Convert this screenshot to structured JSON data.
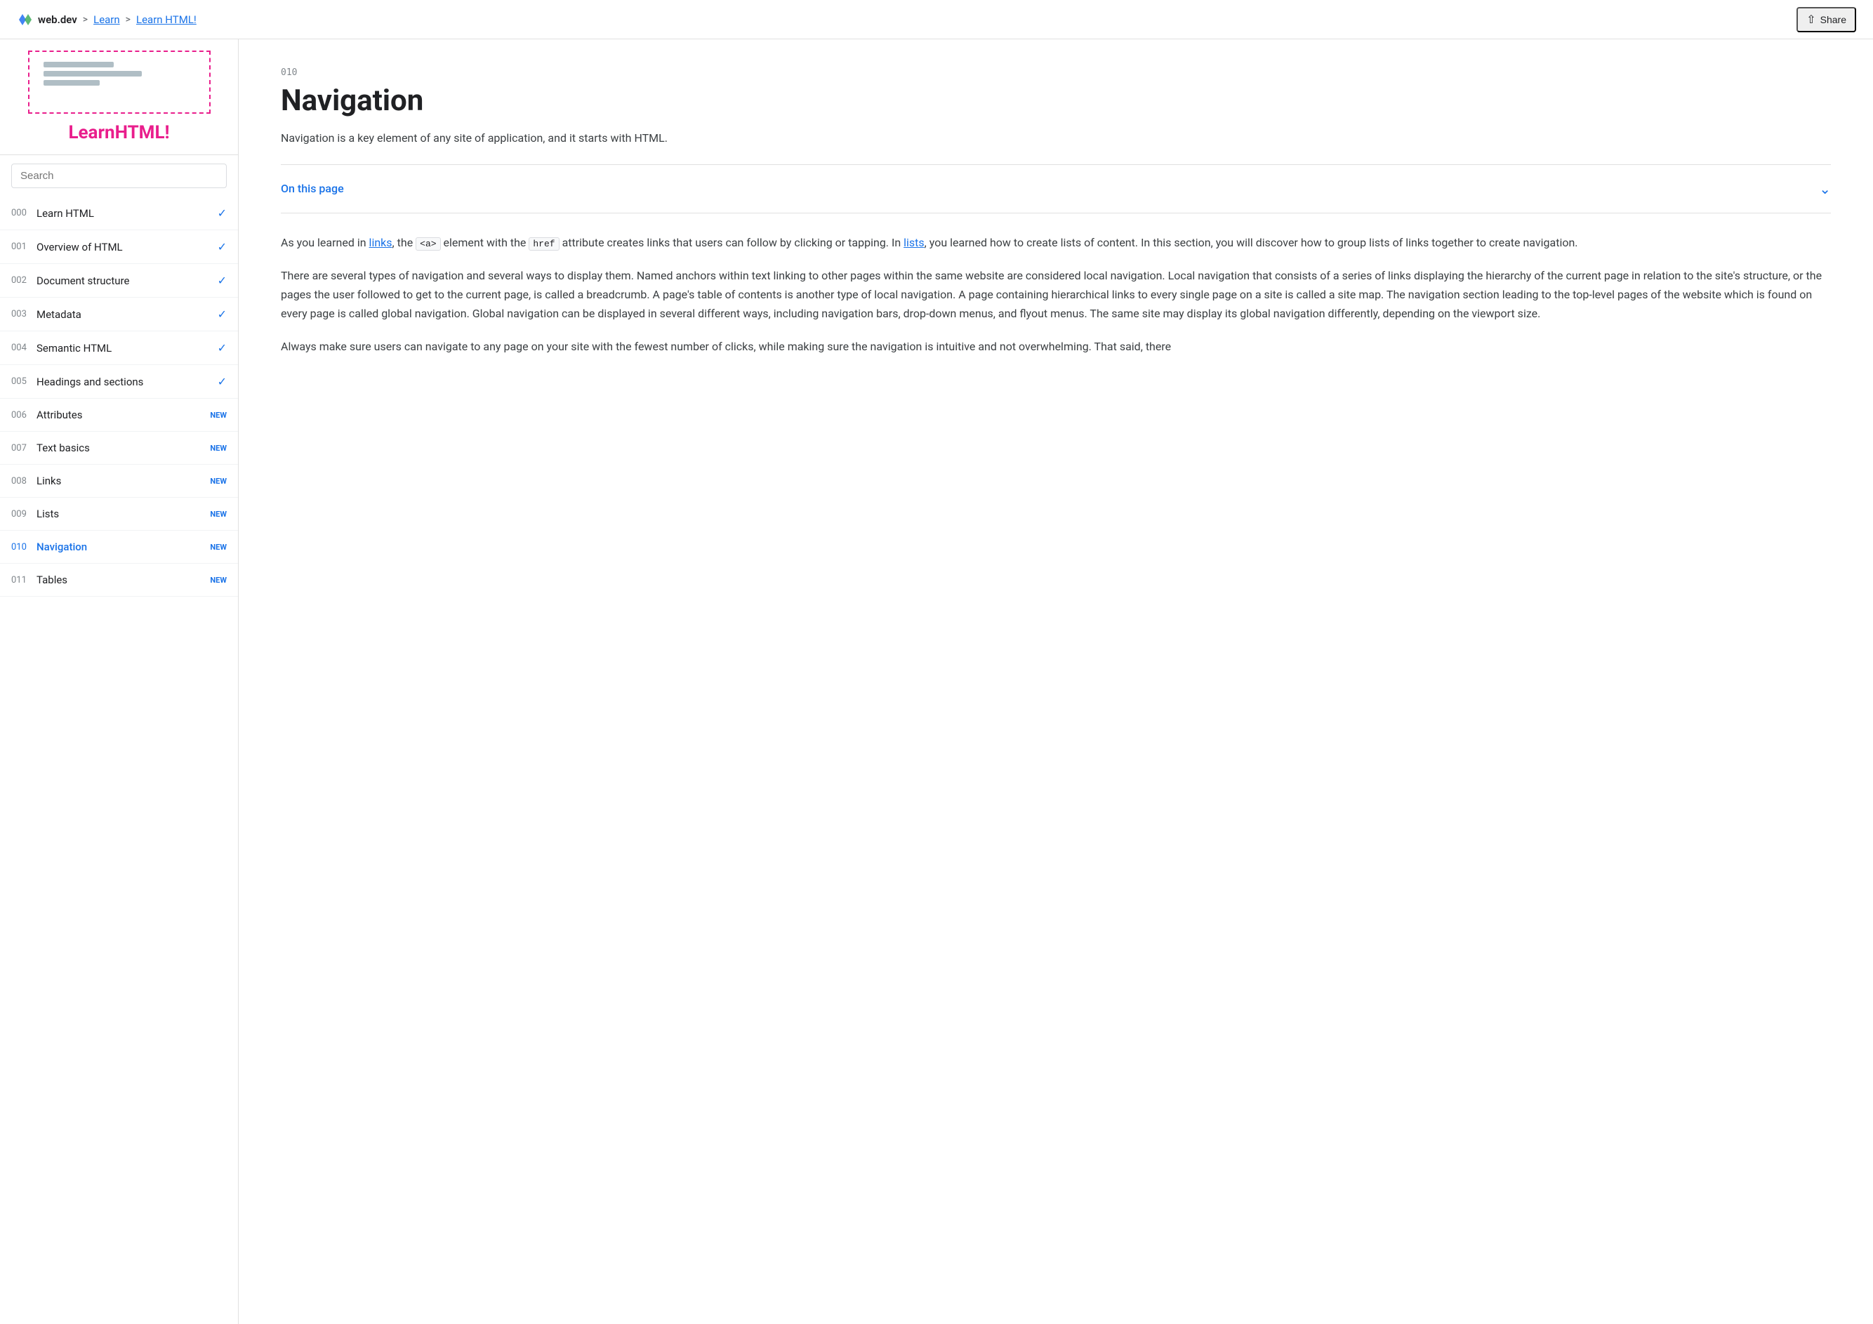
{
  "topnav": {
    "site": "web.dev",
    "sep1": ">",
    "learn": "Learn",
    "sep2": ">",
    "current": "Learn HTML!",
    "share_label": "Share"
  },
  "sidebar": {
    "title_plain": "Learn",
    "title_colored": "HTML!",
    "search_placeholder": "Search",
    "nav_items": [
      {
        "num": "000",
        "label": "Learn HTML",
        "badge": "",
        "check": true,
        "active": false
      },
      {
        "num": "001",
        "label": "Overview of HTML",
        "badge": "",
        "check": true,
        "active": false
      },
      {
        "num": "002",
        "label": "Document structure",
        "badge": "",
        "check": true,
        "active": false
      },
      {
        "num": "003",
        "label": "Metadata",
        "badge": "",
        "check": true,
        "active": false
      },
      {
        "num": "004",
        "label": "Semantic HTML",
        "badge": "",
        "check": true,
        "active": false
      },
      {
        "num": "005",
        "label": "Headings and sections",
        "badge": "",
        "check": true,
        "active": false
      },
      {
        "num": "006",
        "label": "Attributes",
        "badge": "NEW",
        "check": false,
        "active": false
      },
      {
        "num": "007",
        "label": "Text basics",
        "badge": "NEW",
        "check": false,
        "active": false
      },
      {
        "num": "008",
        "label": "Links",
        "badge": "NEW",
        "check": false,
        "active": false
      },
      {
        "num": "009",
        "label": "Lists",
        "badge": "NEW",
        "check": false,
        "active": false
      },
      {
        "num": "010",
        "label": "Navigation",
        "badge": "NEW",
        "check": false,
        "active": true
      },
      {
        "num": "011",
        "label": "Tables",
        "badge": "NEW",
        "check": false,
        "active": false
      }
    ]
  },
  "content": {
    "lesson_num": "010",
    "title": "Navigation",
    "subtitle": "Navigation is a key element of any site of application, and it starts with HTML.",
    "on_this_page": "On this page",
    "para1_prefix": "As you learned in ",
    "para1_link1": "links",
    "para1_mid1": ", the ",
    "para1_code1": "<a>",
    "para1_mid2": " element with the ",
    "para1_code2": "href",
    "para1_mid3": " attribute creates links that users can follow by clicking or tapping. In ",
    "para1_link2": "lists",
    "para1_mid4": ", you learned how to create lists of content. In this section, you will discover how to group lists of links together to create navigation.",
    "para2": "There are several types of navigation and several ways to display them. Named anchors within text linking to other pages within the same website are considered local navigation. Local navigation that consists of a series of links displaying the hierarchy of the current page in relation to the site's structure, or the pages the user followed to get to the current page, is called a breadcrumb. A page's table of contents is another type of local navigation. A page containing hierarchical links to every single page on a site is called a site map. The navigation section leading to the top-level pages of the website which is found on every page is called global navigation. Global navigation can be displayed in several different ways, including navigation bars, drop-down menus, and flyout menus. The same site may display its global navigation differently, depending on the viewport size.",
    "para3_start": "Always make sure users can navigate to any page on your site with the fewest number of clicks, while making sure the navigation is intuitive and not overwhelming. That said, there"
  }
}
